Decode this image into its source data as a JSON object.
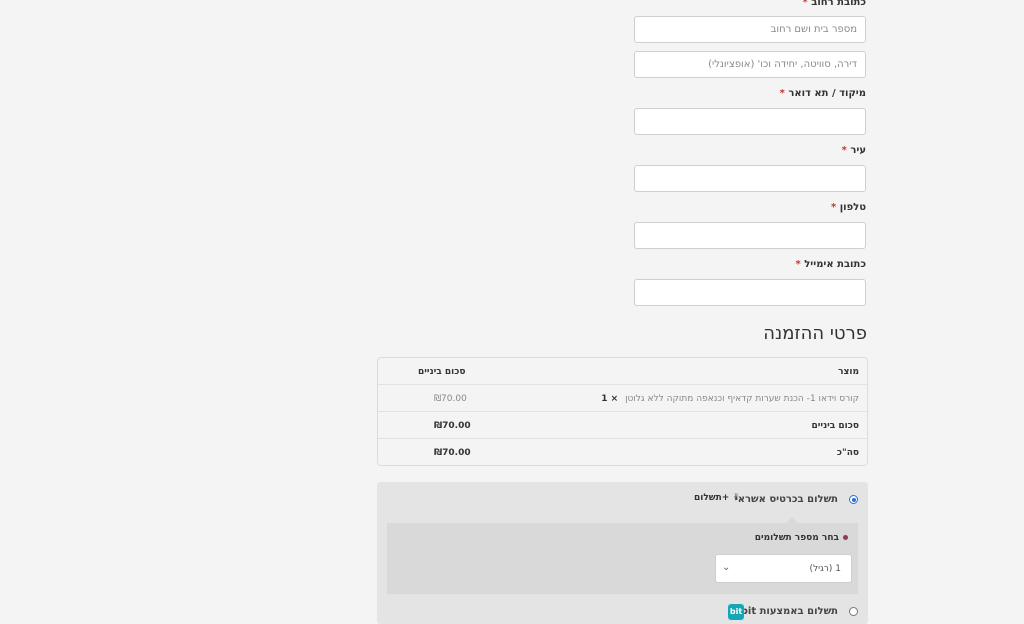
{
  "form": {
    "street_label": "כתובת רחוב",
    "street_placeholder": "מספר בית ושם רחוב",
    "street2_placeholder": "דירה, סוויטה, יחידה וכו' (אופציונלי)",
    "zip_label": "מיקוד / תא דואר",
    "city_label": "עיר",
    "phone_label": "טלפון",
    "email_label": "כתובת אימייל",
    "required_mark": "*"
  },
  "order": {
    "title": "פרטי ההזמנה",
    "header_product": "מוצר",
    "header_subtotal": "סכום ביניים",
    "items": [
      {
        "name": "קורס וידאו 1- הכנת שערות קדאיף וכנאפה מתוקה ללא גלוטן",
        "qty": "× 1",
        "price": "₪70.00"
      }
    ],
    "subtotal_label": "סכום ביניים",
    "subtotal_value": "₪70.00",
    "total_label": "סה\"כ",
    "total_value": "₪70.00"
  },
  "payment": {
    "credit_label": "תשלום בכרטיס אשראי",
    "credit_logo": "תשלום+",
    "credit_selected": true,
    "installments_label": "בחר מספר תשלומים",
    "installments_value": "1 (רגיל)",
    "bit_label": "תשלום באמצעות bit",
    "bit_logo": "bit"
  }
}
